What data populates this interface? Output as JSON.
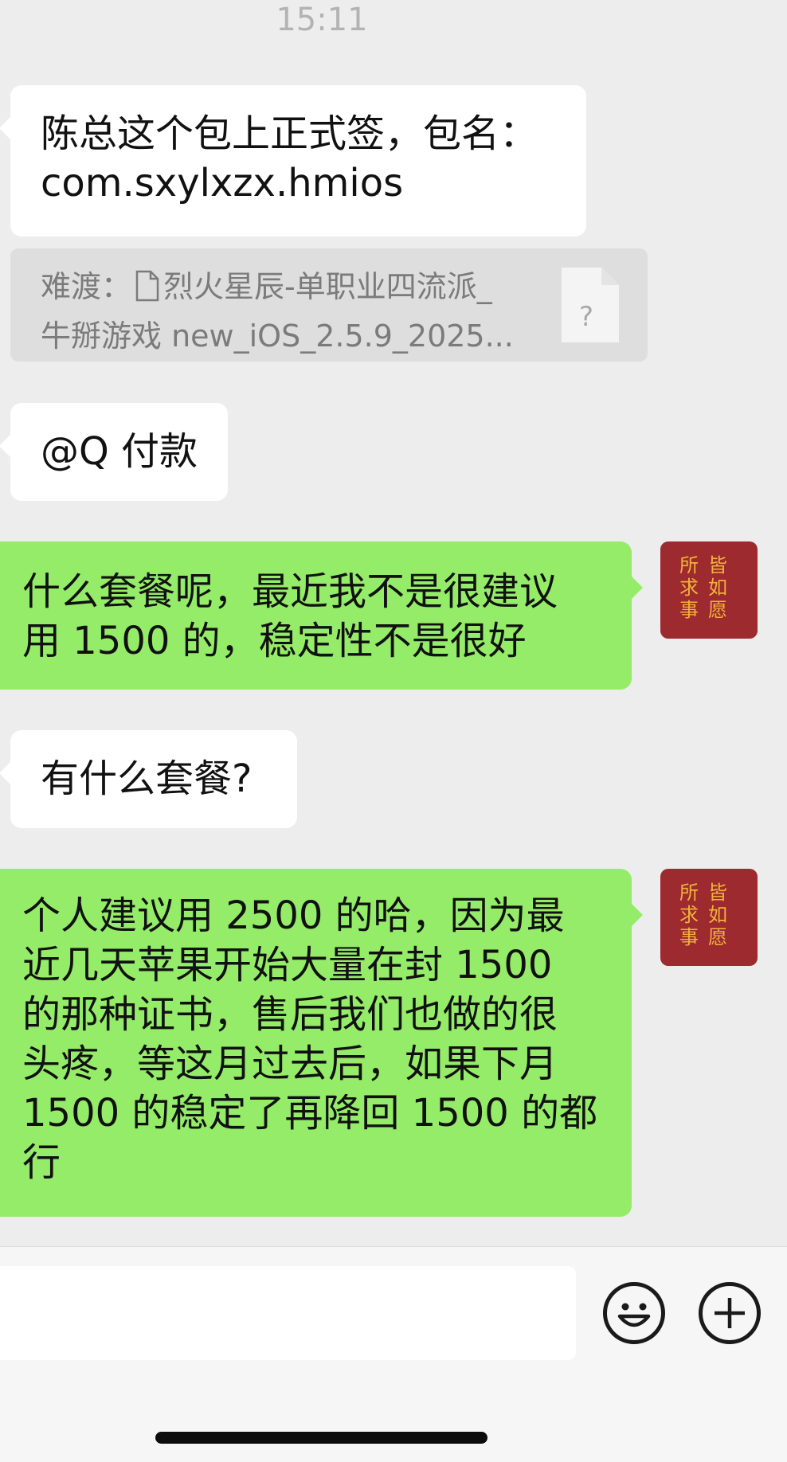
{
  "header": {
    "time": "15:11"
  },
  "messages": [
    {
      "id": "m1",
      "side": "in",
      "lines": [
        "陈总这个包上正式签，包名：",
        "com.sxylxzx.hmios"
      ]
    },
    {
      "id": "q1",
      "type": "quote",
      "prefix": "难渡：",
      "line1": "烈火星辰-单职业四流派_",
      "line2": "牛掰游戏 new_iOS_2.5.9_2025...",
      "file_icon_mark": "?"
    },
    {
      "id": "m2",
      "side": "in",
      "text": "@Q 付款"
    },
    {
      "id": "m3",
      "side": "out",
      "lines": [
        "什么套餐呢，最近我不是很建议",
        "用 1500 的，稳定性不是很好"
      ]
    },
    {
      "id": "m4",
      "side": "in",
      "text": "有什么套餐?"
    },
    {
      "id": "m5",
      "side": "out",
      "lines": [
        "个人建议用 2500 的哈，因为最",
        "近几天苹果开始大量在封 1500",
        "的那种证书，售后我们也做的很",
        "头疼，等这月过去后，如果下月",
        "1500 的稳定了再降回 1500 的都",
        "行"
      ]
    }
  ],
  "avatar": {
    "text_col1": [
      "皆",
      "如",
      "愿"
    ],
    "text_col2": [
      "所",
      "求",
      "事"
    ],
    "bg": "#9d2a2f",
    "fg": "#f0b23a"
  },
  "input_bar": {
    "emoji_icon": "smiley-icon",
    "plus_icon": "plus-circle-icon"
  },
  "colors": {
    "background": "#ededed",
    "outgoing": "#95ec69",
    "incoming": "#ffffff"
  }
}
